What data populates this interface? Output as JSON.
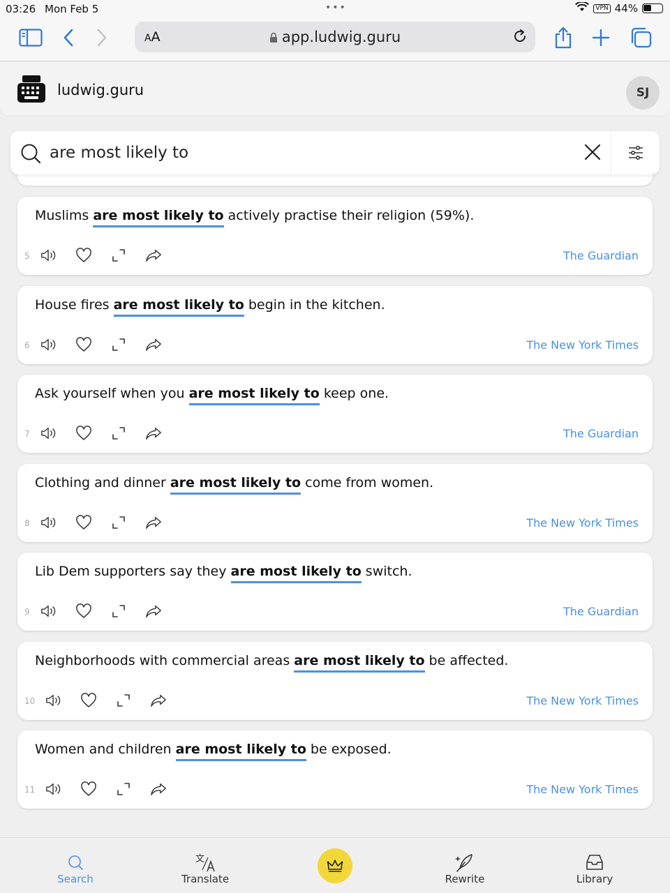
{
  "status": {
    "time": "03:26",
    "date": "Mon Feb 5",
    "vpn": "VPN",
    "battery": "44%",
    "battery_level": 0.44
  },
  "browser": {
    "aa_label_small": "A",
    "aa_label_large": "A",
    "url": "app.ludwig.guru"
  },
  "header": {
    "brand": "ludwig.guru",
    "avatar_initials": "SJ"
  },
  "search": {
    "query": "are most likely to"
  },
  "results": [
    {
      "num": "5",
      "before": "Muslims ",
      "highlight": "are most likely to",
      "after": " actively practise their religion (59%).",
      "source": "The Guardian"
    },
    {
      "num": "6",
      "before": "House fires ",
      "highlight": "are most likely to",
      "after": " begin in the kitchen.",
      "source": "The New York Times"
    },
    {
      "num": "7",
      "before": "Ask yourself when you ",
      "highlight": "are most likely to",
      "after": " keep one.",
      "source": "The Guardian"
    },
    {
      "num": "8",
      "before": "Clothing and dinner ",
      "highlight": "are most likely to",
      "after": " come from women.",
      "source": "The New York Times"
    },
    {
      "num": "9",
      "before": "Lib Dem supporters say they ",
      "highlight": "are most likely to",
      "after": " switch.",
      "source": "The Guardian"
    },
    {
      "num": "10",
      "before": "Neighborhoods with commercial areas ",
      "highlight": "are most likely to",
      "after": " be affected.",
      "source": "The New York Times"
    },
    {
      "num": "11",
      "before": "Women and children ",
      "highlight": "are most likely to",
      "after": " be exposed.",
      "source": "The New York Times"
    }
  ],
  "tabs": {
    "search": "Search",
    "translate": "Translate",
    "rewrite": "Rewrite",
    "library": "Library"
  },
  "colors": {
    "accent": "#4a90e2",
    "premium": "#f2d73a"
  }
}
